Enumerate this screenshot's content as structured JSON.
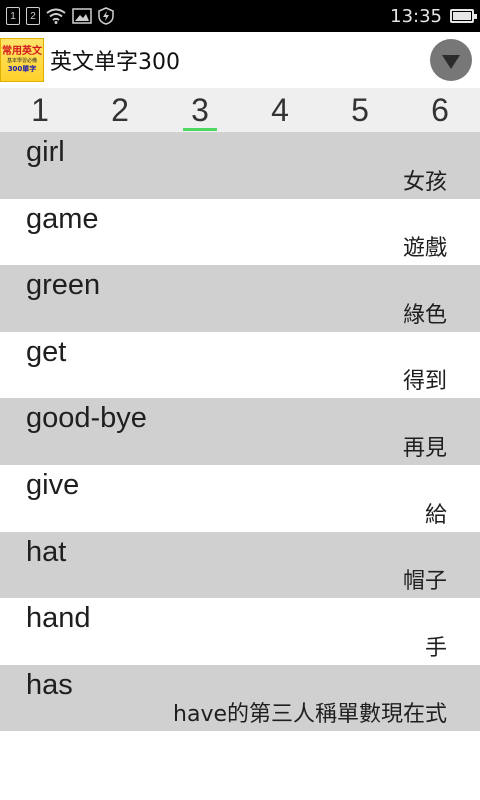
{
  "status_bar": {
    "sim1": "1",
    "sim2": "2",
    "time": "13:35"
  },
  "app_bar": {
    "logo": {
      "line1": "常用英文",
      "line2": "基本學習必備",
      "line3": "300單字"
    },
    "title": "英文单字300",
    "menu_icon": "triangle-down"
  },
  "tabs": [
    {
      "label": "1",
      "active": false
    },
    {
      "label": "2",
      "active": false
    },
    {
      "label": "3",
      "active": true
    },
    {
      "label": "4",
      "active": false
    },
    {
      "label": "5",
      "active": false
    },
    {
      "label": "6",
      "active": false
    }
  ],
  "colors": {
    "active_tab_indicator": "#4cd964",
    "row_gray": "#d0d0d0",
    "row_white": "#ffffff"
  },
  "words": [
    {
      "english": "girl",
      "chinese": "女孩"
    },
    {
      "english": "game",
      "chinese": "遊戲"
    },
    {
      "english": "green",
      "chinese": "綠色"
    },
    {
      "english": "get",
      "chinese": "得到"
    },
    {
      "english": "good-bye",
      "chinese": "再見"
    },
    {
      "english": "give",
      "chinese": "給"
    },
    {
      "english": "hat",
      "chinese": "帽子"
    },
    {
      "english": "hand",
      "chinese": "手"
    },
    {
      "english": "has",
      "chinese": "have的第三人稱單數現在式"
    }
  ]
}
